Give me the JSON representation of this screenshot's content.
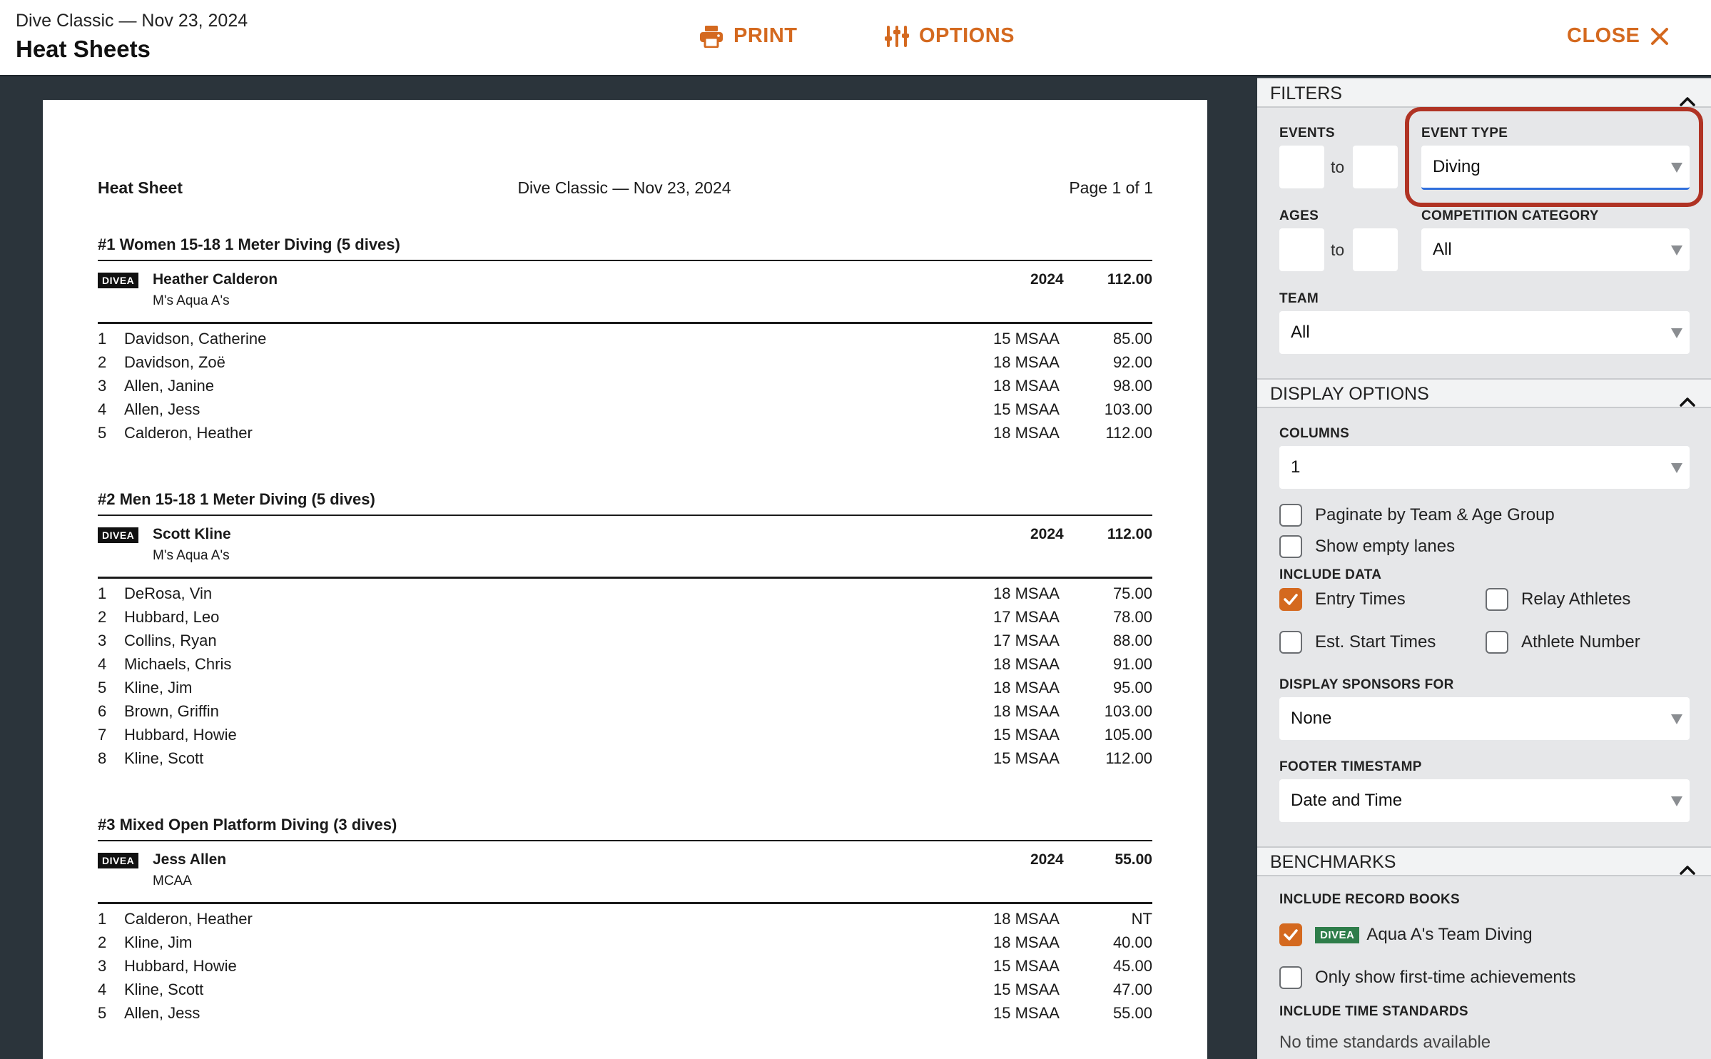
{
  "header": {
    "meet_subtitle": "Dive Classic — Nov 23, 2024",
    "title": "Heat Sheets",
    "print_label": "PRINT",
    "options_label": "OPTIONS",
    "close_label": "CLOSE",
    "accent_color": "#d4691f"
  },
  "sheet": {
    "left": "Heat Sheet",
    "center": "Dive Classic — Nov 23, 2024",
    "right": "Page 1 of 1",
    "events": [
      {
        "title": "#1 Women 15-18 1 Meter Diving (5 dives)",
        "record": {
          "badge": "DIVEA",
          "name": "Heather Calderon",
          "team": "M's Aqua A's",
          "year": "2024",
          "score": "112.00"
        },
        "entries": [
          {
            "num": "1",
            "name": "Davidson, Catherine",
            "age_team": "15 MSAA",
            "score": "85.00"
          },
          {
            "num": "2",
            "name": "Davidson, Zoë",
            "age_team": "18 MSAA",
            "score": "92.00"
          },
          {
            "num": "3",
            "name": "Allen, Janine",
            "age_team": "18 MSAA",
            "score": "98.00"
          },
          {
            "num": "4",
            "name": "Allen, Jess",
            "age_team": "15 MSAA",
            "score": "103.00"
          },
          {
            "num": "5",
            "name": "Calderon, Heather",
            "age_team": "18 MSAA",
            "score": "112.00"
          }
        ]
      },
      {
        "title": "#2 Men 15-18 1 Meter Diving (5 dives)",
        "record": {
          "badge": "DIVEA",
          "name": "Scott Kline",
          "team": "M's Aqua A's",
          "year": "2024",
          "score": "112.00"
        },
        "entries": [
          {
            "num": "1",
            "name": "DeRosa, Vin",
            "age_team": "18 MSAA",
            "score": "75.00"
          },
          {
            "num": "2",
            "name": "Hubbard, Leo",
            "age_team": "17 MSAA",
            "score": "78.00"
          },
          {
            "num": "3",
            "name": "Collins, Ryan",
            "age_team": "17 MSAA",
            "score": "88.00"
          },
          {
            "num": "4",
            "name": "Michaels, Chris",
            "age_team": "18 MSAA",
            "score": "91.00"
          },
          {
            "num": "5",
            "name": "Kline, Jim",
            "age_team": "18 MSAA",
            "score": "95.00"
          },
          {
            "num": "6",
            "name": "Brown, Griffin",
            "age_team": "18 MSAA",
            "score": "103.00"
          },
          {
            "num": "7",
            "name": "Hubbard, Howie",
            "age_team": "15 MSAA",
            "score": "105.00"
          },
          {
            "num": "8",
            "name": "Kline, Scott",
            "age_team": "15 MSAA",
            "score": "112.00"
          }
        ]
      },
      {
        "title": "#3 Mixed Open Platform Diving (3 dives)",
        "record": {
          "badge": "DIVEA",
          "name": "Jess Allen",
          "team": "MCAA",
          "year": "2024",
          "score": "55.00"
        },
        "entries": [
          {
            "num": "1",
            "name": "Calderon, Heather",
            "age_team": "18 MSAA",
            "score": "NT"
          },
          {
            "num": "2",
            "name": "Kline, Jim",
            "age_team": "18 MSAA",
            "score": "40.00"
          },
          {
            "num": "3",
            "name": "Hubbard, Howie",
            "age_team": "15 MSAA",
            "score": "45.00"
          },
          {
            "num": "4",
            "name": "Kline, Scott",
            "age_team": "15 MSAA",
            "score": "47.00"
          },
          {
            "num": "5",
            "name": "Allen, Jess",
            "age_team": "15 MSAA",
            "score": "55.00"
          }
        ]
      }
    ]
  },
  "filters": {
    "heading": "FILTERS",
    "events_label": "EVENTS",
    "events_from": "",
    "events_to": "",
    "to_text": "to",
    "event_type_label": "EVENT TYPE",
    "event_type_value": "Diving",
    "ages_label": "AGES",
    "ages_from": "",
    "ages_to": "",
    "competition_label": "COMPETITION CATEGORY",
    "competition_value": "All",
    "team_label": "TEAM",
    "team_value": "All"
  },
  "display": {
    "heading": "DISPLAY OPTIONS",
    "columns_label": "COLUMNS",
    "columns_value": "1",
    "paginate": {
      "label": "Paginate by Team & Age Group",
      "checked": false
    },
    "empty_lanes": {
      "label": "Show empty lanes",
      "checked": false
    },
    "include_data_label": "INCLUDE DATA",
    "entry_times": {
      "label": "Entry Times",
      "checked": true
    },
    "relay_athletes": {
      "label": "Relay Athletes",
      "checked": false
    },
    "est_start": {
      "label": "Est. Start Times",
      "checked": false
    },
    "athlete_number": {
      "label": "Athlete Number",
      "checked": false
    },
    "sponsors_label": "DISPLAY SPONSORS FOR",
    "sponsors_value": "None",
    "footer_label": "FOOTER TIMESTAMP",
    "footer_value": "Date and Time"
  },
  "benchmarks": {
    "heading": "BENCHMARKS",
    "record_books_label": "INCLUDE RECORD BOOKS",
    "record_book": {
      "badge": "DIVEA",
      "label": "Aqua A's Team Diving",
      "checked": true
    },
    "first_time": {
      "label": "Only show first-time achievements",
      "checked": false
    },
    "time_standards_label": "INCLUDE TIME STANDARDS",
    "time_standards_empty": "No time standards available"
  }
}
